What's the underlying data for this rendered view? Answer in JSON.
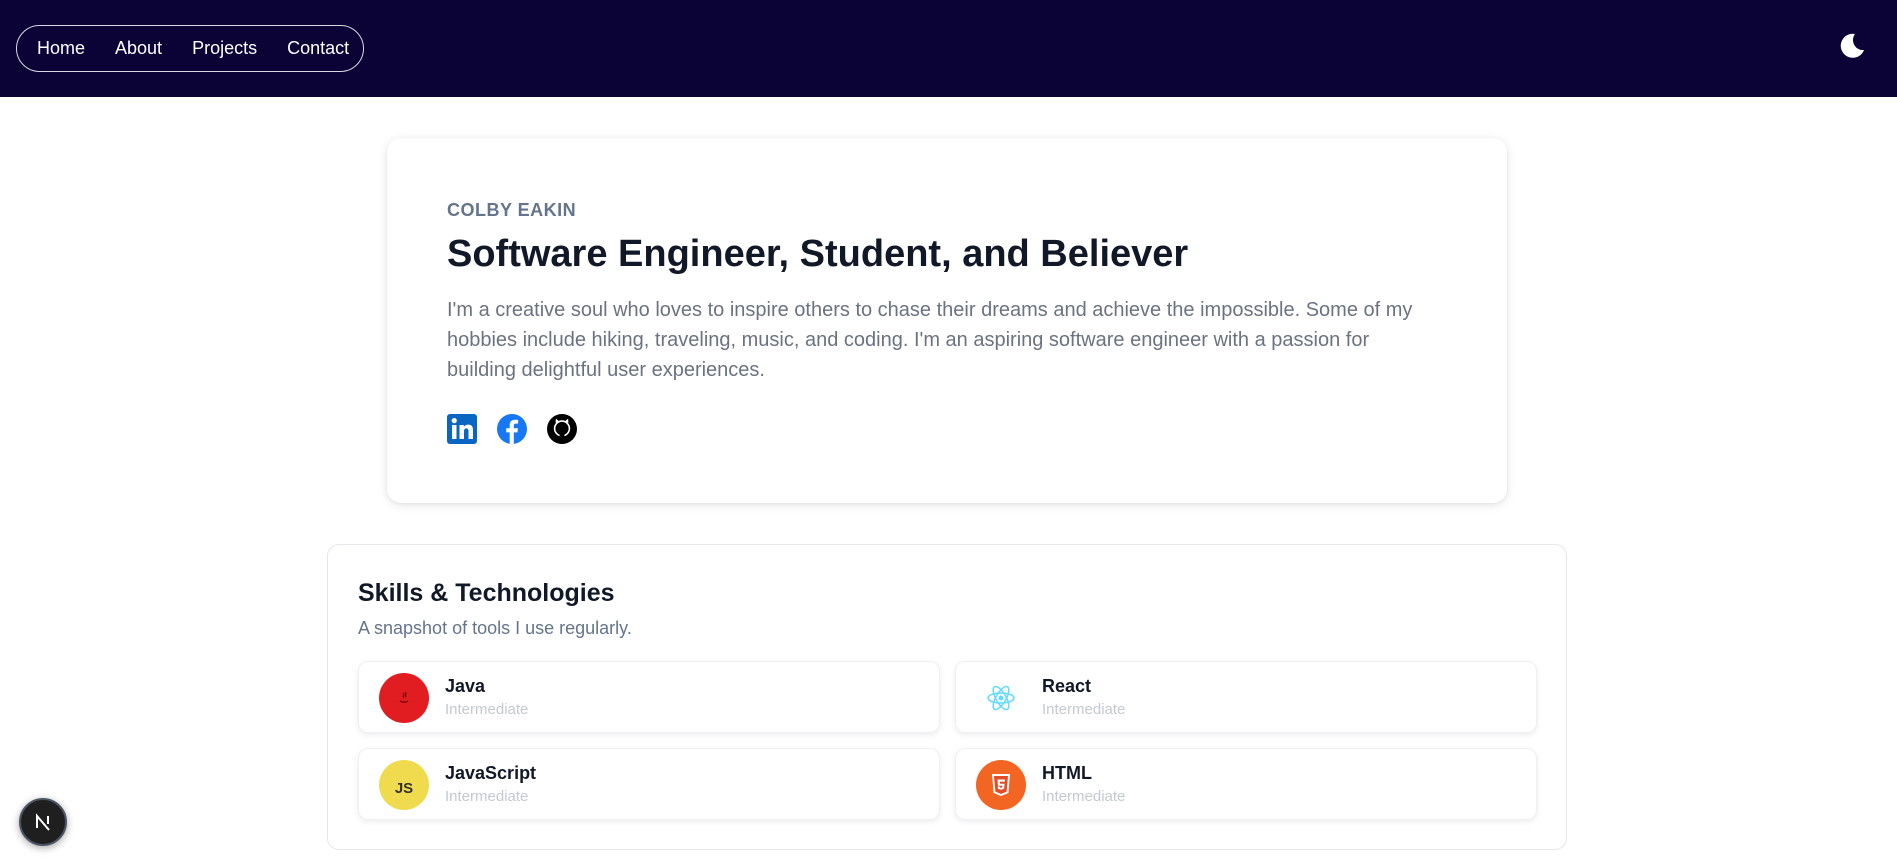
{
  "nav": {
    "items": [
      {
        "label": "Home"
      },
      {
        "label": "About"
      },
      {
        "label": "Projects"
      },
      {
        "label": "Contact"
      }
    ],
    "theme_toggle_icon": "moon-icon",
    "background": "#0b0336"
  },
  "hero": {
    "eyebrow": "COLBY EAKIN",
    "headline": "Software Engineer, Student, and Believer",
    "bio": "I'm a creative soul who loves to inspire others to chase their dreams and achieve the impossible. Some of my hobbies include hiking, traveling, music, and coding. I'm an aspiring software engineer with a passion for building delightful user experiences.",
    "socials": [
      {
        "icon": "linkedin-icon",
        "color": "#0a66c2"
      },
      {
        "icon": "facebook-icon",
        "color": "#1877f2"
      },
      {
        "icon": "github-icon",
        "color": "#000000"
      }
    ]
  },
  "skills": {
    "title": "Skills & Technologies",
    "subtitle": "A snapshot of tools I use regularly.",
    "items": [
      {
        "name": "Java",
        "level": "Intermediate",
        "icon": "java-icon",
        "color": "#e11d22"
      },
      {
        "name": "React",
        "level": "Intermediate",
        "icon": "react-icon",
        "color": "#61dafb"
      },
      {
        "name": "JavaScript",
        "level": "Intermediate",
        "icon": "javascript-icon",
        "color": "#f0db4f",
        "icon_text": "JS"
      },
      {
        "name": "HTML",
        "level": "Intermediate",
        "icon": "html5-icon",
        "color": "#f26522"
      }
    ]
  },
  "dev_badge": {
    "icon": "nextjs-icon",
    "letter": "N"
  }
}
